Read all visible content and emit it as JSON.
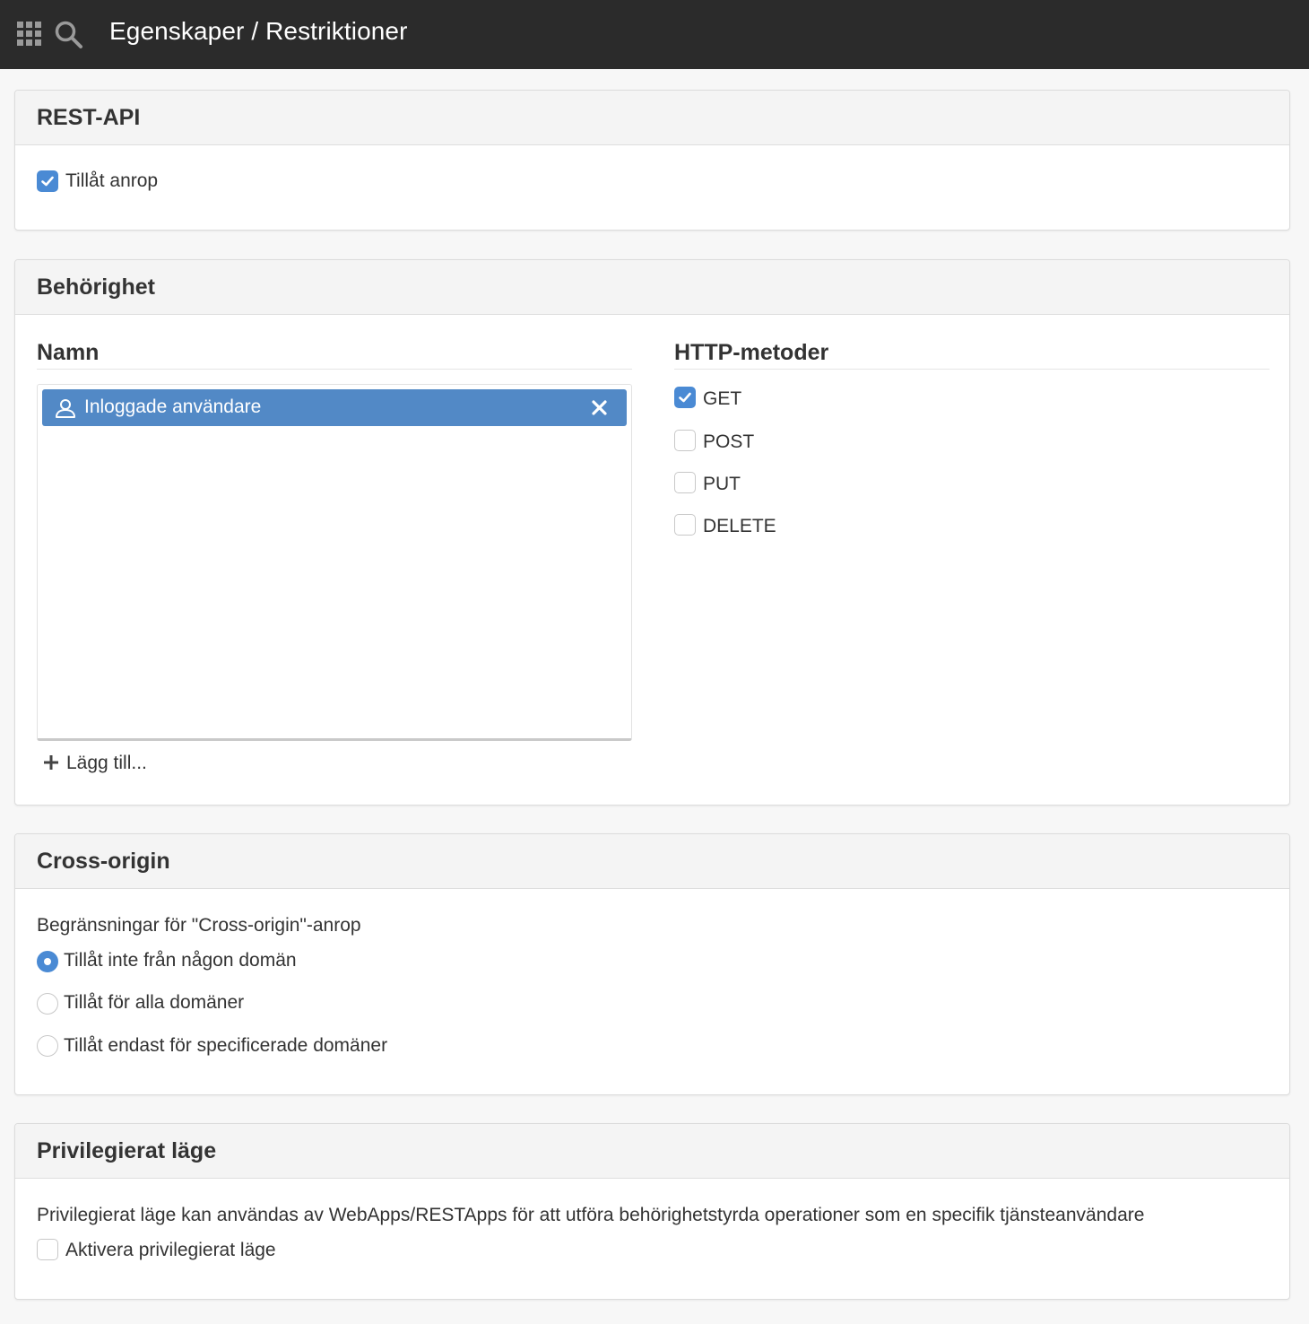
{
  "topbar": {
    "title": "Egenskaper / Restriktioner",
    "apps_icon": "grid-icon",
    "search_icon": "search-icon"
  },
  "rest_api": {
    "title": "REST-API",
    "allow_calls": {
      "label": "Tillåt anrop",
      "checked": true
    }
  },
  "behorighet": {
    "title": "Behörighet",
    "name_column": {
      "title": "Namn",
      "items": [
        {
          "label": "Inloggade användare",
          "icon": "user-icon"
        }
      ],
      "add_label": "Lägg till..."
    },
    "http_column": {
      "title": "HTTP-metoder",
      "methods": [
        {
          "label": "GET",
          "checked": true
        },
        {
          "label": "POST",
          "checked": false
        },
        {
          "label": "PUT",
          "checked": false
        },
        {
          "label": "DELETE",
          "checked": false
        }
      ]
    }
  },
  "cross_origin": {
    "title": "Cross-origin",
    "description": "Begränsningar för \"Cross-origin\"-anrop",
    "options": [
      {
        "label": "Tillåt inte från någon domän",
        "selected": true
      },
      {
        "label": "Tillåt för alla domäner",
        "selected": false
      },
      {
        "label": "Tillåt endast för specificerade domäner",
        "selected": false
      }
    ]
  },
  "privileged": {
    "title": "Privilegierat läge",
    "description": "Privilegierat läge kan användas av WebApps/RESTApps för att utföra behörighetstyrda operationer som en specifik tjänsteanvändare",
    "activate": {
      "label": "Aktivera privilegierat läge",
      "checked": false
    }
  },
  "colors": {
    "topbar": "#2b2b2b",
    "accent": "#4a8ad4",
    "selected_item": "#5289c6",
    "panel_header": "#f4f4f4"
  }
}
